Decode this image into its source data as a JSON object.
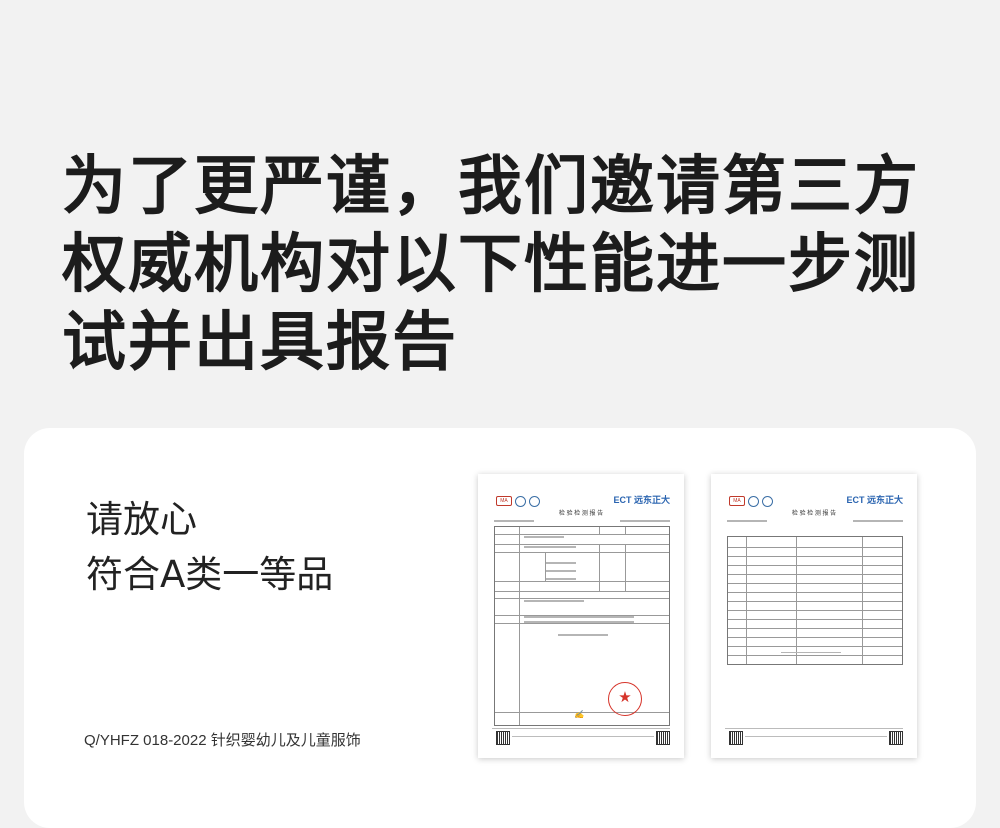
{
  "headline": "为了更严谨，我们邀请第三方权威机构对以下性能进一步测试并出具报告",
  "card": {
    "line1": "请放心",
    "line2": "符合A类一等品",
    "standard": "Q/YHFZ 018-2022 针织婴幼儿及儿童服饰"
  },
  "reports": [
    {
      "brand": "ECT 远东正大",
      "title": "检 验 检 测 报 告"
    },
    {
      "brand": "ECT 远东正大",
      "title": "检 验 检 测 报 告"
    }
  ],
  "colors": {
    "background": "#f2f2f2",
    "card": "#ffffff",
    "text": "#1c1c1c",
    "brand_blue": "#2a64b0",
    "stamp_red": "#d6342a"
  }
}
